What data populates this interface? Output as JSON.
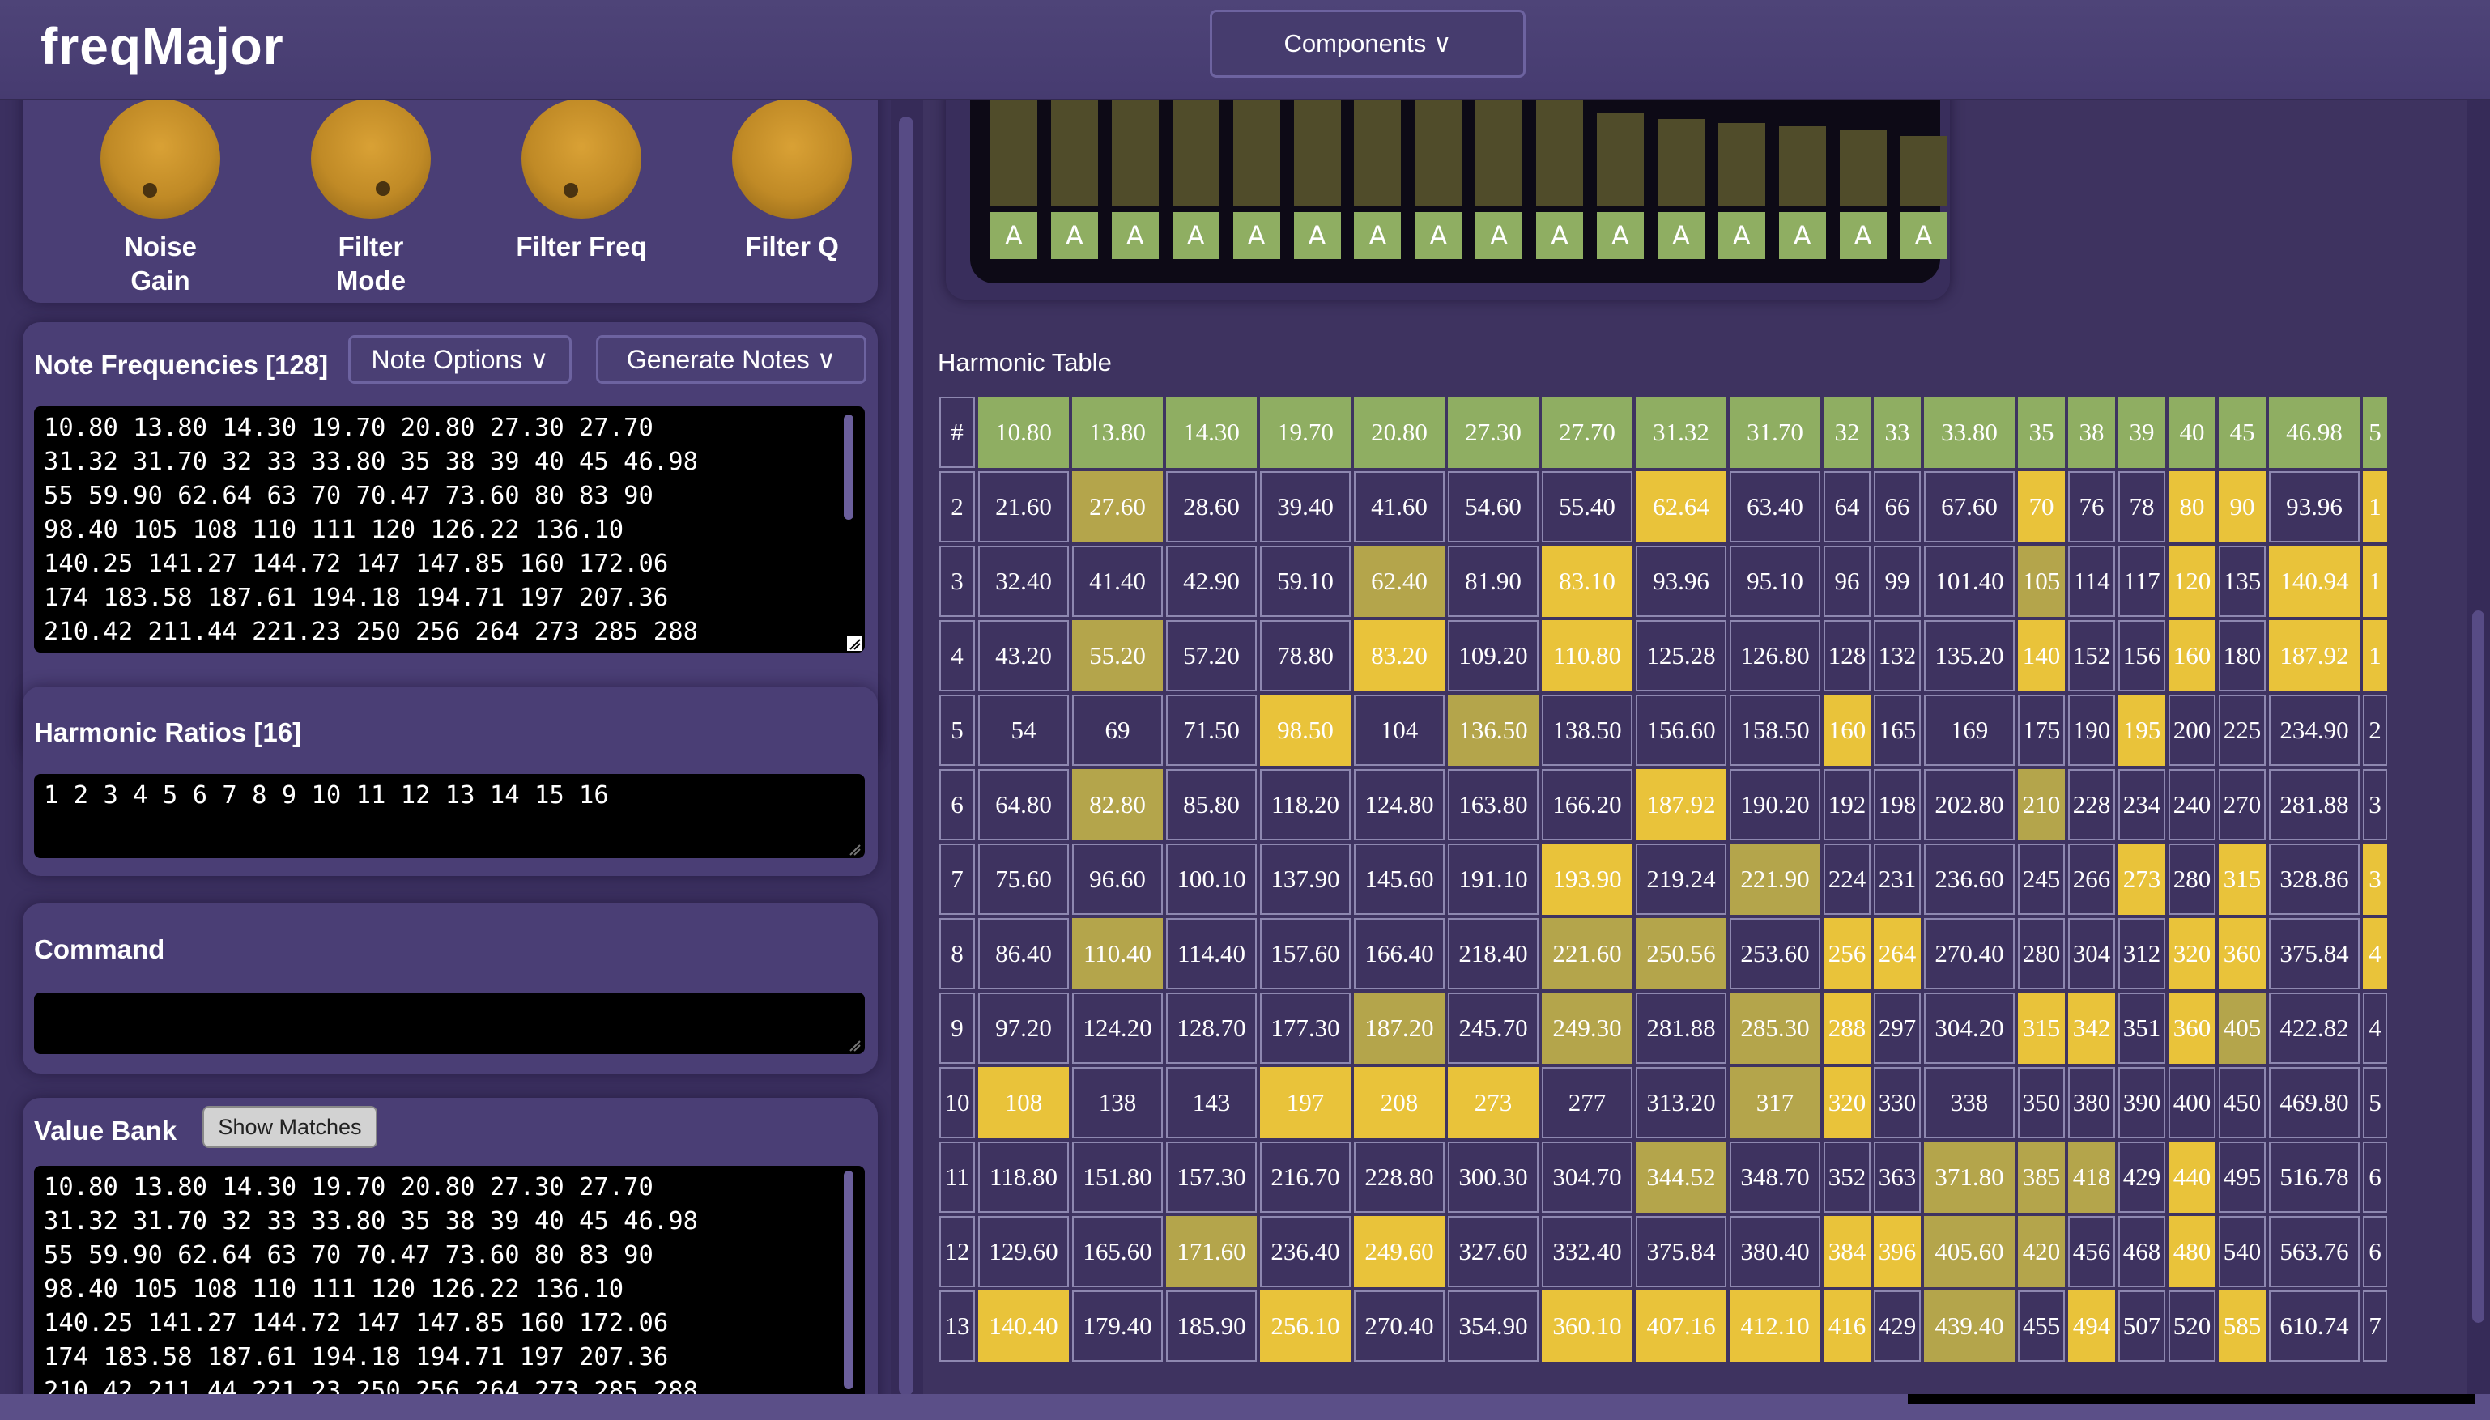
{
  "app": {
    "title": "freqMajor",
    "components_label": "Components ∨"
  },
  "knobs": [
    {
      "label": "Noise\nGain",
      "dot": "bl"
    },
    {
      "label": "Filter\nMode",
      "dot": "br"
    },
    {
      "label": "Filter Freq",
      "dot": "bl"
    },
    {
      "label": "Filter Q",
      "dot": "none"
    }
  ],
  "note_freqs": {
    "title": "Note Frequencies [128]",
    "note_options_label": "Note Options ∨",
    "generate_notes_label": "Generate Notes ∨",
    "text": "10.80 13.80 14.30 19.70 20.80 27.30 27.70\n31.32 31.70 32 33 33.80 35 38 39 40 45 46.98\n55 59.90 62.64 63 70 70.47 73.60 80 83 90\n98.40 105 108 110 111 120 126.22 136.10\n140.25 141.27 144.72 147 147.85 160 172.06\n174 183.58 187.61 194.18 194.71 197 207.36\n210.42 211.44 221.23 250 256 264 273 285 288"
  },
  "harmonic_ratios": {
    "title": "Harmonic Ratios [16]",
    "text": "1 2 3 4 5 6 7 8 9 10 11 12 13 14 15 16"
  },
  "command": {
    "title": "Command",
    "value": ""
  },
  "value_bank": {
    "title": "Value Bank",
    "show_matches_label": "Show Matches",
    "text": "10.80 13.80 14.30 19.70 20.80 27.30 27.70\n31.32 31.70 32 33 33.80 35 38 39 40 45 46.98\n55 59.90 62.64 63 70 70.47 73.60 80 83 90\n98.40 105 108 110 111 120 126.22 136.10\n140.25 141.27 144.72 147 147.85 160 172.06\n174 183.58 187.61 194.18 194.71 197 207.36\n210.42 211.44 221.23 250 256 264 273 285 288"
  },
  "meter": {
    "button_label": "A",
    "levels": [
      1.0,
      1.0,
      1.0,
      1.0,
      1.0,
      1.0,
      1.0,
      1.0,
      1.0,
      0.82,
      0.72,
      0.67,
      0.64,
      0.61,
      0.58,
      0.54
    ]
  },
  "harmonic_table": {
    "title": "Harmonic Table",
    "header_label": "#",
    "columns": [
      "10.80",
      "13.80",
      "14.30",
      "19.70",
      "20.80",
      "27.30",
      "27.70",
      "31.32",
      "31.70",
      "32",
      "33",
      "33.80",
      "35",
      "38",
      "39",
      "40",
      "45",
      "46.98",
      "5"
    ],
    "rows": [
      {
        "n": "2",
        "cells": [
          "21.60",
          "27.60",
          "28.60",
          "39.40",
          "41.60",
          "54.60",
          "55.40",
          "62.64",
          "63.40",
          "64",
          "66",
          "67.60",
          "70",
          "76",
          "78",
          "80",
          "90",
          "93.96",
          "1"
        ],
        "marks": "-d-----m----m--mm-m"
      },
      {
        "n": "3",
        "cells": [
          "32.40",
          "41.40",
          "42.90",
          "59.10",
          "62.40",
          "81.90",
          "83.10",
          "93.96",
          "95.10",
          "96",
          "99",
          "101.40",
          "105",
          "114",
          "117",
          "120",
          "135",
          "140.94",
          "1"
        ],
        "marks": "----d-m-----d--m-mm"
      },
      {
        "n": "4",
        "cells": [
          "43.20",
          "55.20",
          "57.20",
          "78.80",
          "83.20",
          "109.20",
          "110.80",
          "125.28",
          "126.80",
          "128",
          "132",
          "135.20",
          "140",
          "152",
          "156",
          "160",
          "180",
          "187.92",
          "1"
        ],
        "marks": "-d--m-m-----m--m-mm"
      },
      {
        "n": "5",
        "cells": [
          "54",
          "69",
          "71.50",
          "98.50",
          "104",
          "136.50",
          "138.50",
          "156.60",
          "158.50",
          "160",
          "165",
          "169",
          "175",
          "190",
          "195",
          "200",
          "225",
          "234.90",
          "2"
        ],
        "marks": "---m-d---m----m----"
      },
      {
        "n": "6",
        "cells": [
          "64.80",
          "82.80",
          "85.80",
          "118.20",
          "124.80",
          "163.80",
          "166.20",
          "187.92",
          "190.20",
          "192",
          "198",
          "202.80",
          "210",
          "228",
          "234",
          "240",
          "270",
          "281.88",
          "3"
        ],
        "marks": "-d-----m----d------"
      },
      {
        "n": "7",
        "cells": [
          "75.60",
          "96.60",
          "100.10",
          "137.90",
          "145.60",
          "191.10",
          "193.90",
          "219.24",
          "221.90",
          "224",
          "231",
          "236.60",
          "245",
          "266",
          "273",
          "280",
          "315",
          "328.86",
          "3"
        ],
        "marks": "------m-d-----m-m-m"
      },
      {
        "n": "8",
        "cells": [
          "86.40",
          "110.40",
          "114.40",
          "157.60",
          "166.40",
          "218.40",
          "221.60",
          "250.56",
          "253.60",
          "256",
          "264",
          "270.40",
          "280",
          "304",
          "312",
          "320",
          "360",
          "375.84",
          "4"
        ],
        "marks": "-d----dd-mm----mm-m"
      },
      {
        "n": "9",
        "cells": [
          "97.20",
          "124.20",
          "128.70",
          "177.30",
          "187.20",
          "245.70",
          "249.30",
          "281.88",
          "285.30",
          "288",
          "297",
          "304.20",
          "315",
          "342",
          "351",
          "360",
          "405",
          "422.82",
          "4"
        ],
        "marks": "----d-d-dm--mm-md--"
      },
      {
        "n": "10",
        "cells": [
          "108",
          "138",
          "143",
          "197",
          "208",
          "273",
          "277",
          "313.20",
          "317",
          "320",
          "330",
          "338",
          "350",
          "380",
          "390",
          "400",
          "450",
          "469.80",
          "5"
        ],
        "marks": "m--mmm--dm---------"
      },
      {
        "n": "11",
        "cells": [
          "118.80",
          "151.80",
          "157.30",
          "216.70",
          "228.80",
          "300.30",
          "304.70",
          "344.52",
          "348.70",
          "352",
          "363",
          "371.80",
          "385",
          "418",
          "429",
          "440",
          "495",
          "516.78",
          "6"
        ],
        "marks": "-------d---ddd-m---"
      },
      {
        "n": "12",
        "cells": [
          "129.60",
          "165.60",
          "171.60",
          "236.40",
          "249.60",
          "327.60",
          "332.40",
          "375.84",
          "380.40",
          "384",
          "396",
          "405.60",
          "420",
          "456",
          "468",
          "480",
          "540",
          "563.76",
          "6"
        ],
        "marks": "--d-m----mmdd--m---"
      },
      {
        "n": "13",
        "cells": [
          "140.40",
          "179.40",
          "185.90",
          "256.10",
          "270.40",
          "354.90",
          "360.10",
          "407.16",
          "412.10",
          "416",
          "429",
          "439.40",
          "455",
          "494",
          "507",
          "520",
          "585",
          "610.74",
          "7"
        ],
        "marks": "m--m--mmmm-d-m--m--"
      }
    ]
  }
}
